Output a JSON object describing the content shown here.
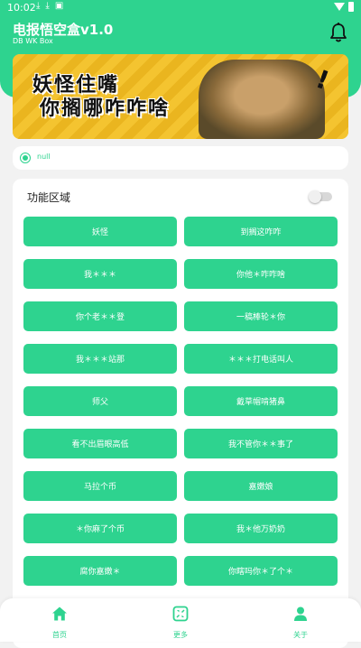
{
  "status_bar": {
    "time": "10:02"
  },
  "header": {
    "title": "电报悟空盒v1.0",
    "subtitle": "DB WK Box"
  },
  "banner": {
    "line1": "妖怪住嘴",
    "line2": "你搁哪咋咋啥",
    "exclaim": "!"
  },
  "option": {
    "label": "null"
  },
  "functions": {
    "title": "功能区域",
    "toggle_on": false,
    "buttons": [
      "妖怪",
      "到搁这咋咋",
      "我＊＊＊",
      "你他＊咋咋啥",
      "你个老＊＊登",
      "一稿棒轮＊你",
      "我＊＊＊站那",
      "＊＊＊打电话叫人",
      "师父",
      "戴草帽啃猪鼻",
      "看不出眉眼高低",
      "我不管你＊＊事了",
      "马拉个币",
      "嘉嫩娘",
      "＊你麻了个币",
      "我＊他万奶奶",
      "腐你嘉嫩＊",
      "你瞎吗你＊了个＊"
    ]
  },
  "bottom_nav": [
    {
      "label": "首页",
      "icon": "home-icon"
    },
    {
      "label": "更多",
      "icon": "more-icon"
    },
    {
      "label": "关于",
      "icon": "user-icon"
    }
  ],
  "colors": {
    "accent": "#2ed38f",
    "background": "#f2f2f2"
  }
}
